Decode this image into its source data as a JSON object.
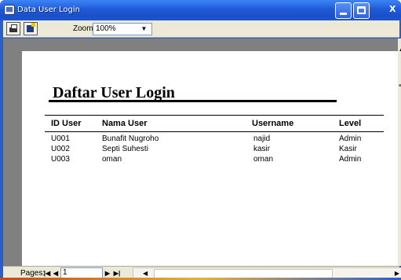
{
  "window": {
    "title": "Data User Login",
    "controls": {
      "minimize_icon": "minimize-icon",
      "maximize_icon": "maximize-icon",
      "close_icon": "close-icon",
      "close_glyph": "X"
    }
  },
  "toolbar": {
    "print_icon": "printer-icon",
    "export_icon": "export-icon",
    "zoom_label": "Zoom",
    "zoom_value": "100%",
    "zoom_arrow": "▼"
  },
  "report": {
    "title": "Daftar User Login",
    "columns": [
      "ID User",
      "Nama User",
      "Username",
      "Level"
    ],
    "rows": [
      [
        "U001",
        "Bunafit Nugroho",
        "najid",
        "Admin"
      ],
      [
        "U002",
        "Septi Suhesti",
        "kasir",
        "Kasir"
      ],
      [
        "U003",
        "oman",
        "oman",
        "Admin"
      ]
    ]
  },
  "pager": {
    "label": "Pages:",
    "first_icon": "first-page-icon",
    "prev_icon": "prev-page-icon",
    "current_page": "1",
    "next_icon": "next-page-icon",
    "last_icon": "last-page-icon",
    "first_glyph": "|◀",
    "prev_glyph": "◀",
    "next_glyph": "▶",
    "last_glyph": "▶|",
    "scroll_left": "◀",
    "scroll_right": "▶"
  },
  "vscroll": {
    "up_glyph": "▲",
    "mark_glyph": "≡"
  }
}
